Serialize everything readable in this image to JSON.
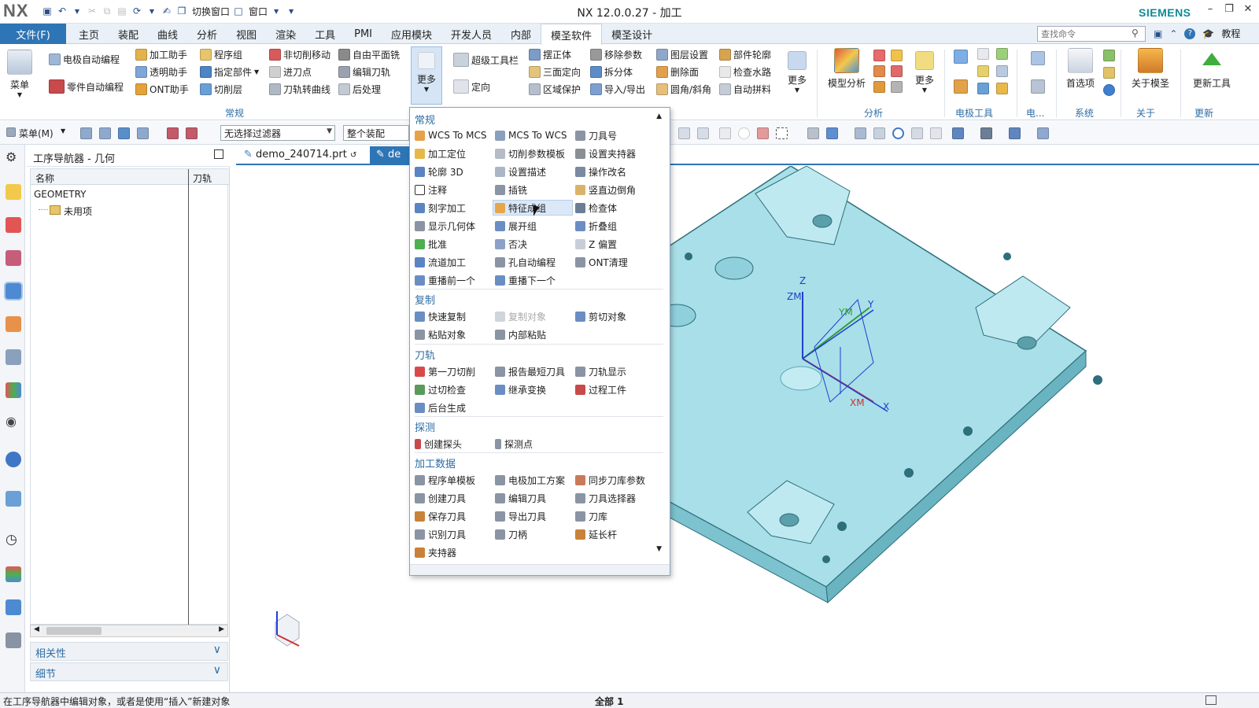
{
  "titlebar": {
    "logo": "NX",
    "title": "NX 12.0.0.27 - 加工",
    "brand": "SIEMENS",
    "switch_window": "切换窗口",
    "window_menu": "窗口"
  },
  "menubar": {
    "file": "文件(F)",
    "tabs": [
      "主页",
      "装配",
      "曲线",
      "分析",
      "视图",
      "渲染",
      "工具",
      "PMI",
      "应用模块",
      "开发人员",
      "内部",
      "模圣软件",
      "模圣设计"
    ],
    "active_tab": "模圣软件",
    "search_placeholder": "查找命令",
    "tutorial": "教程"
  },
  "ribbon": {
    "menu_label": "菜单",
    "col1": [
      "电极自动编程",
      "零件自动编程"
    ],
    "col2": [
      "加工助手",
      "透明助手",
      "ONT助手"
    ],
    "col3": [
      "程序组",
      "指定部件",
      "切削层"
    ],
    "col4": [
      "非切削移动",
      "进刀点",
      "刀轨转曲线"
    ],
    "col5": [
      "自由平面铣",
      "编辑刀轨",
      "后处理"
    ],
    "more1": "更多",
    "col6": [
      "超级工具栏",
      "定向"
    ],
    "col7": [
      "摆正体",
      "三面定向",
      "区域保护"
    ],
    "col8": [
      "移除参数",
      "拆分体",
      "导入/导出"
    ],
    "col9": [
      "图层设置",
      "删除面",
      "圆角/斜角"
    ],
    "col10": [
      "部件轮廓",
      "检查水路",
      "自动拼料"
    ],
    "more2": "更多",
    "model_analysis": "模型分析",
    "more3": "更多",
    "prefs": "首选项",
    "about": "关于模圣",
    "update": "更新工具",
    "groups": {
      "general": "常规",
      "analysis": "分析",
      "electrode": "电极工具",
      "elec": "电...",
      "system": "系统",
      "about": "关于",
      "update": "更新"
    }
  },
  "toolbar": {
    "menu": "菜单(M)",
    "filter": "无选择过滤器",
    "assembly": "整个装配"
  },
  "navigator": {
    "title": "工序导航器 - 几何",
    "col_name": "名称",
    "col_toolpath": "刀轨",
    "rows": [
      "GEOMETRY",
      "未用项"
    ],
    "panel_related": "相关性",
    "panel_details": "细节"
  },
  "doctabs": {
    "file1": "demo_240714.prt",
    "file2": "de"
  },
  "dropdown": {
    "sections": {
      "general": "常规",
      "copy": "复制",
      "toolpath": "刀轨",
      "probe": "探测",
      "data": "加工数据"
    },
    "general_items": [
      [
        "WCS To MCS",
        "MCS To WCS",
        "刀具号"
      ],
      [
        "加工定位",
        "切削参数模板",
        "设置夹持器"
      ],
      [
        "轮廓 3D",
        "设置描述",
        "操作改名"
      ],
      [
        "注释",
        "插铣",
        "竖直边倒角"
      ],
      [
        "刻字加工",
        "特征成组",
        "检查体"
      ],
      [
        "显示几何体",
        "展开组",
        "折叠组"
      ],
      [
        "批准",
        "否决",
        "Z 偏置"
      ],
      [
        "流道加工",
        "孔自动编程",
        "ONT清理"
      ],
      [
        "重播前一个",
        "重播下一个",
        ""
      ]
    ],
    "copy_items": [
      [
        "快速复制",
        "复制对象",
        "剪切对象"
      ],
      [
        "粘贴对象",
        "内部粘贴",
        ""
      ]
    ],
    "toolpath_items": [
      [
        "第一刀切削",
        "报告最短刀具",
        "刀轨显示"
      ],
      [
        "过切检查",
        "继承变换",
        "过程工件"
      ],
      [
        "后台生成",
        "",
        ""
      ]
    ],
    "probe_items": [
      [
        "创建探头",
        "探测点",
        ""
      ]
    ],
    "data_items": [
      [
        "程序单模板",
        "电极加工方案",
        "同步刀库参数"
      ],
      [
        "创建刀具",
        "编辑刀具",
        "刀具选择器"
      ],
      [
        "保存刀具",
        "导出刀具",
        "刀库"
      ],
      [
        "识别刀具",
        "刀柄",
        "延长杆"
      ],
      [
        "夹持器",
        "",
        ""
      ]
    ]
  },
  "viewport": {
    "axis_labels": {
      "z": "Z",
      "zm": "ZM",
      "ym": "YM",
      "y": "Y",
      "xm": "XM",
      "x": "X"
    }
  },
  "status": {
    "message": "在工序导航器中编辑对象，或者是使用“插入”新建对象",
    "count": "全部 1"
  },
  "colors": {
    "accent": "#2e75b6",
    "part": "#a9dfe8",
    "part_edge": "#2d6f7b"
  }
}
